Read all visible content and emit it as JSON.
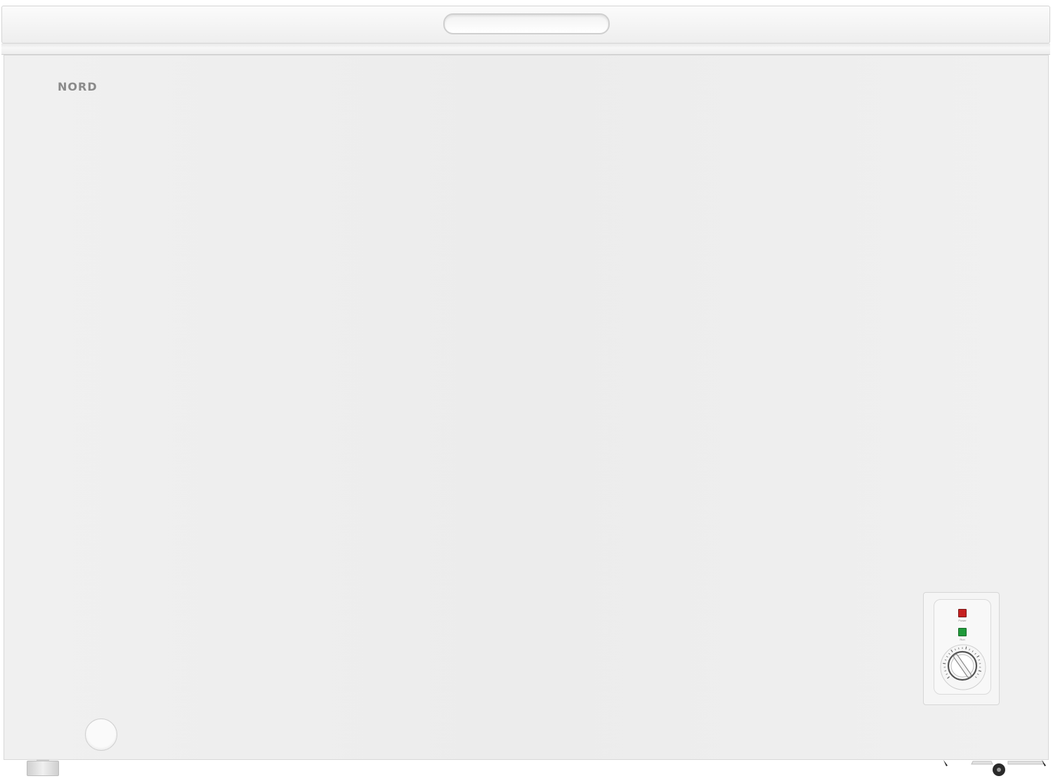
{
  "product": {
    "brand": "NORD"
  },
  "controls": {
    "power_label": "Power",
    "run_label": "Run",
    "power_led_color": "#c62020",
    "run_led_color": "#1f9a3a"
  },
  "colors": {
    "body": "#eeeeee",
    "brand_text": "#8a8a8a"
  }
}
